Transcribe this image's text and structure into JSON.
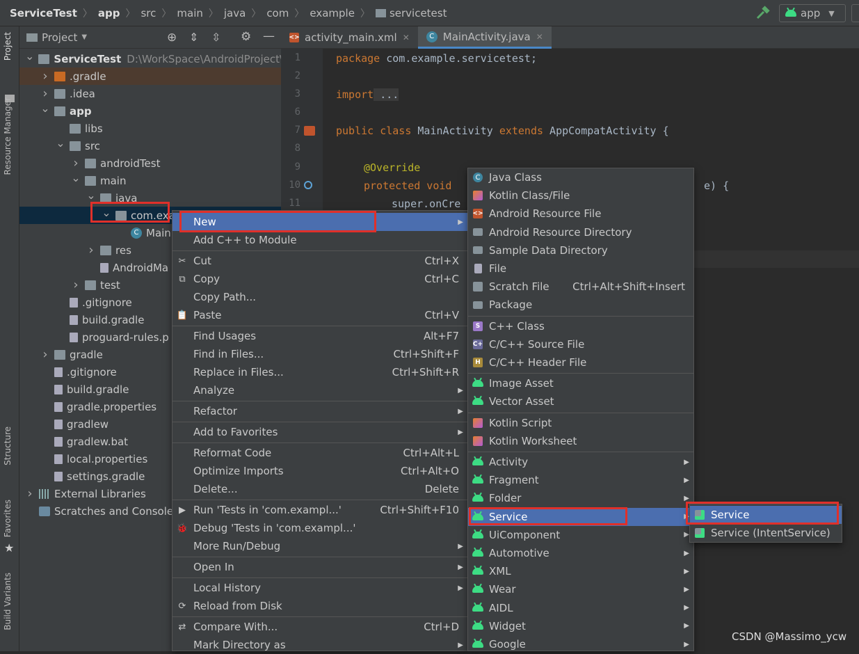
{
  "breadcrumb": [
    "ServiceTest",
    "app",
    "src",
    "main",
    "java",
    "com",
    "example",
    "servicetest"
  ],
  "run_config": "app",
  "left_tabs": [
    "Project",
    "Resource Manager",
    "Structure",
    "Favorites",
    "Build Variants"
  ],
  "project_panel": {
    "title": "Project"
  },
  "tree": [
    {
      "label": "ServiceTest",
      "path": "D:\\WorkSpace\\AndroidProject\\S",
      "indent": 0,
      "arrow": "down",
      "icon": "module",
      "bold": true
    },
    {
      "label": ".gradle",
      "indent": 1,
      "arrow": "right",
      "icon": "folder-orange"
    },
    {
      "label": ".idea",
      "indent": 1,
      "arrow": "right",
      "icon": "folder"
    },
    {
      "label": "app",
      "indent": 1,
      "arrow": "down",
      "icon": "folder",
      "bold": true
    },
    {
      "label": "libs",
      "indent": 2,
      "arrow": "",
      "icon": "folder"
    },
    {
      "label": "src",
      "indent": 2,
      "arrow": "down",
      "icon": "folder"
    },
    {
      "label": "androidTest",
      "indent": 3,
      "arrow": "right",
      "icon": "folder"
    },
    {
      "label": "main",
      "indent": 3,
      "arrow": "down",
      "icon": "folder"
    },
    {
      "label": "java",
      "indent": 4,
      "arrow": "down",
      "icon": "folder"
    },
    {
      "label": "com.exa",
      "indent": 5,
      "arrow": "down",
      "icon": "folder",
      "selected": true
    },
    {
      "label": "Main",
      "indent": 6,
      "arrow": "",
      "icon": "class"
    },
    {
      "label": "res",
      "indent": 4,
      "arrow": "right",
      "icon": "folder"
    },
    {
      "label": "AndroidMa",
      "indent": 4,
      "arrow": "",
      "icon": "file"
    },
    {
      "label": "test",
      "indent": 3,
      "arrow": "right",
      "icon": "folder"
    },
    {
      "label": ".gitignore",
      "indent": 2,
      "arrow": "",
      "icon": "file"
    },
    {
      "label": "build.gradle",
      "indent": 2,
      "arrow": "",
      "icon": "file"
    },
    {
      "label": "proguard-rules.p",
      "indent": 2,
      "arrow": "",
      "icon": "file"
    },
    {
      "label": "gradle",
      "indent": 1,
      "arrow": "right",
      "icon": "folder"
    },
    {
      "label": ".gitignore",
      "indent": 1,
      "arrow": "",
      "icon": "file"
    },
    {
      "label": "build.gradle",
      "indent": 1,
      "arrow": "",
      "icon": "file"
    },
    {
      "label": "gradle.properties",
      "indent": 1,
      "arrow": "",
      "icon": "file"
    },
    {
      "label": "gradlew",
      "indent": 1,
      "arrow": "",
      "icon": "file"
    },
    {
      "label": "gradlew.bat",
      "indent": 1,
      "arrow": "",
      "icon": "file"
    },
    {
      "label": "local.properties",
      "indent": 1,
      "arrow": "",
      "icon": "file"
    },
    {
      "label": "settings.gradle",
      "indent": 1,
      "arrow": "",
      "icon": "file"
    },
    {
      "label": "External Libraries",
      "indent": 0,
      "arrow": "right",
      "icon": "lib"
    },
    {
      "label": "Scratches and Consoles",
      "indent": 0,
      "arrow": "",
      "icon": "scratch"
    }
  ],
  "editor_tabs": [
    {
      "label": "activity_main.xml",
      "active": false
    },
    {
      "label": "MainActivity.java",
      "active": true
    }
  ],
  "line_numbers": [
    "1",
    "2",
    "3",
    "6",
    "7",
    "8",
    "9",
    "10",
    "11"
  ],
  "code": {
    "l1a": "package",
    "l1b": " com.example.servicetest;",
    "l3a": "import",
    "l3b": " ...",
    "l7a": "public class",
    "l7b": " MainActivity ",
    "l7c": "extends",
    "l7d": " AppCompatActivity {",
    "l9": "@Override",
    "l10a": "protected void",
    "l10b": " e) {",
    "l11": "super.onCre"
  },
  "context_menu": [
    {
      "label": "New",
      "sub": true,
      "active": true
    },
    {
      "label": "Add C++ to Module"
    },
    {
      "sep": true
    },
    {
      "label": "Cut",
      "shortcut": "Ctrl+X",
      "icon": "✂"
    },
    {
      "label": "Copy",
      "shortcut": "Ctrl+C",
      "icon": "⧉"
    },
    {
      "label": "Copy Path..."
    },
    {
      "label": "Paste",
      "shortcut": "Ctrl+V",
      "icon": "📋"
    },
    {
      "sep": true
    },
    {
      "label": "Find Usages",
      "shortcut": "Alt+F7"
    },
    {
      "label": "Find in Files...",
      "shortcut": "Ctrl+Shift+F"
    },
    {
      "label": "Replace in Files...",
      "shortcut": "Ctrl+Shift+R"
    },
    {
      "label": "Analyze",
      "sub": true
    },
    {
      "sep": true
    },
    {
      "label": "Refactor",
      "sub": true
    },
    {
      "sep": true
    },
    {
      "label": "Add to Favorites",
      "sub": true
    },
    {
      "sep": true
    },
    {
      "label": "Reformat Code",
      "shortcut": "Ctrl+Alt+L"
    },
    {
      "label": "Optimize Imports",
      "shortcut": "Ctrl+Alt+O"
    },
    {
      "label": "Delete...",
      "shortcut": "Delete"
    },
    {
      "sep": true
    },
    {
      "label": "Run 'Tests in 'com.exampl...'",
      "shortcut": "Ctrl+Shift+F10",
      "icon": "▶"
    },
    {
      "label": "Debug 'Tests in 'com.exampl...'",
      "icon": "🐞"
    },
    {
      "label": "More Run/Debug",
      "sub": true
    },
    {
      "sep": true
    },
    {
      "label": "Open In",
      "sub": true
    },
    {
      "sep": true
    },
    {
      "label": "Local History",
      "sub": true
    },
    {
      "label": "Reload from Disk",
      "icon": "⟳"
    },
    {
      "sep": true
    },
    {
      "label": "Compare With...",
      "shortcut": "Ctrl+D",
      "icon": "⇄"
    },
    {
      "label": "Mark Directory as",
      "sub": true
    }
  ],
  "new_menu": [
    {
      "label": "Java Class",
      "icon": "class"
    },
    {
      "label": "Kotlin Class/File",
      "icon": "kotlin"
    },
    {
      "label": "Android Resource File",
      "icon": "resfile"
    },
    {
      "label": "Android Resource Directory",
      "icon": "folder"
    },
    {
      "label": "Sample Data Directory",
      "icon": "folder"
    },
    {
      "label": "File",
      "icon": "file"
    },
    {
      "label": "Scratch File",
      "shortcut": "Ctrl+Alt+Shift+Insert",
      "icon": "scratch"
    },
    {
      "label": "Package",
      "icon": "folder"
    },
    {
      "sep": true
    },
    {
      "label": "C++ Class",
      "icon": "cpp"
    },
    {
      "label": "C/C++ Source File",
      "icon": "cppsrc"
    },
    {
      "label": "C/C++ Header File",
      "icon": "cpphdr"
    },
    {
      "sep": true
    },
    {
      "label": "Image Asset",
      "icon": "android"
    },
    {
      "label": "Vector Asset",
      "icon": "android"
    },
    {
      "sep": true
    },
    {
      "label": "Kotlin Script",
      "icon": "kotlin"
    },
    {
      "label": "Kotlin Worksheet",
      "icon": "kotlin"
    },
    {
      "sep": true
    },
    {
      "label": "Activity",
      "icon": "android",
      "sub": true
    },
    {
      "label": "Fragment",
      "icon": "android",
      "sub": true
    },
    {
      "label": "Folder",
      "icon": "android",
      "sub": true
    },
    {
      "label": "Service",
      "icon": "android",
      "sub": true,
      "active": true
    },
    {
      "label": "UiComponent",
      "icon": "android",
      "sub": true
    },
    {
      "label": "Automotive",
      "icon": "android",
      "sub": true
    },
    {
      "label": "XML",
      "icon": "android",
      "sub": true
    },
    {
      "label": "Wear",
      "icon": "android",
      "sub": true
    },
    {
      "label": "AIDL",
      "icon": "android",
      "sub": true
    },
    {
      "label": "Widget",
      "icon": "android",
      "sub": true
    },
    {
      "label": "Google",
      "icon": "android",
      "sub": true
    }
  ],
  "service_menu": [
    {
      "label": "Service",
      "active": true
    },
    {
      "label": "Service (IntentService)"
    }
  ],
  "watermark": "CSDN @Massimo_ycw",
  "colors": {
    "menu_active": "#4b6eaf",
    "highlight_box": "#e0302a",
    "android_green": "#3ddc84"
  }
}
